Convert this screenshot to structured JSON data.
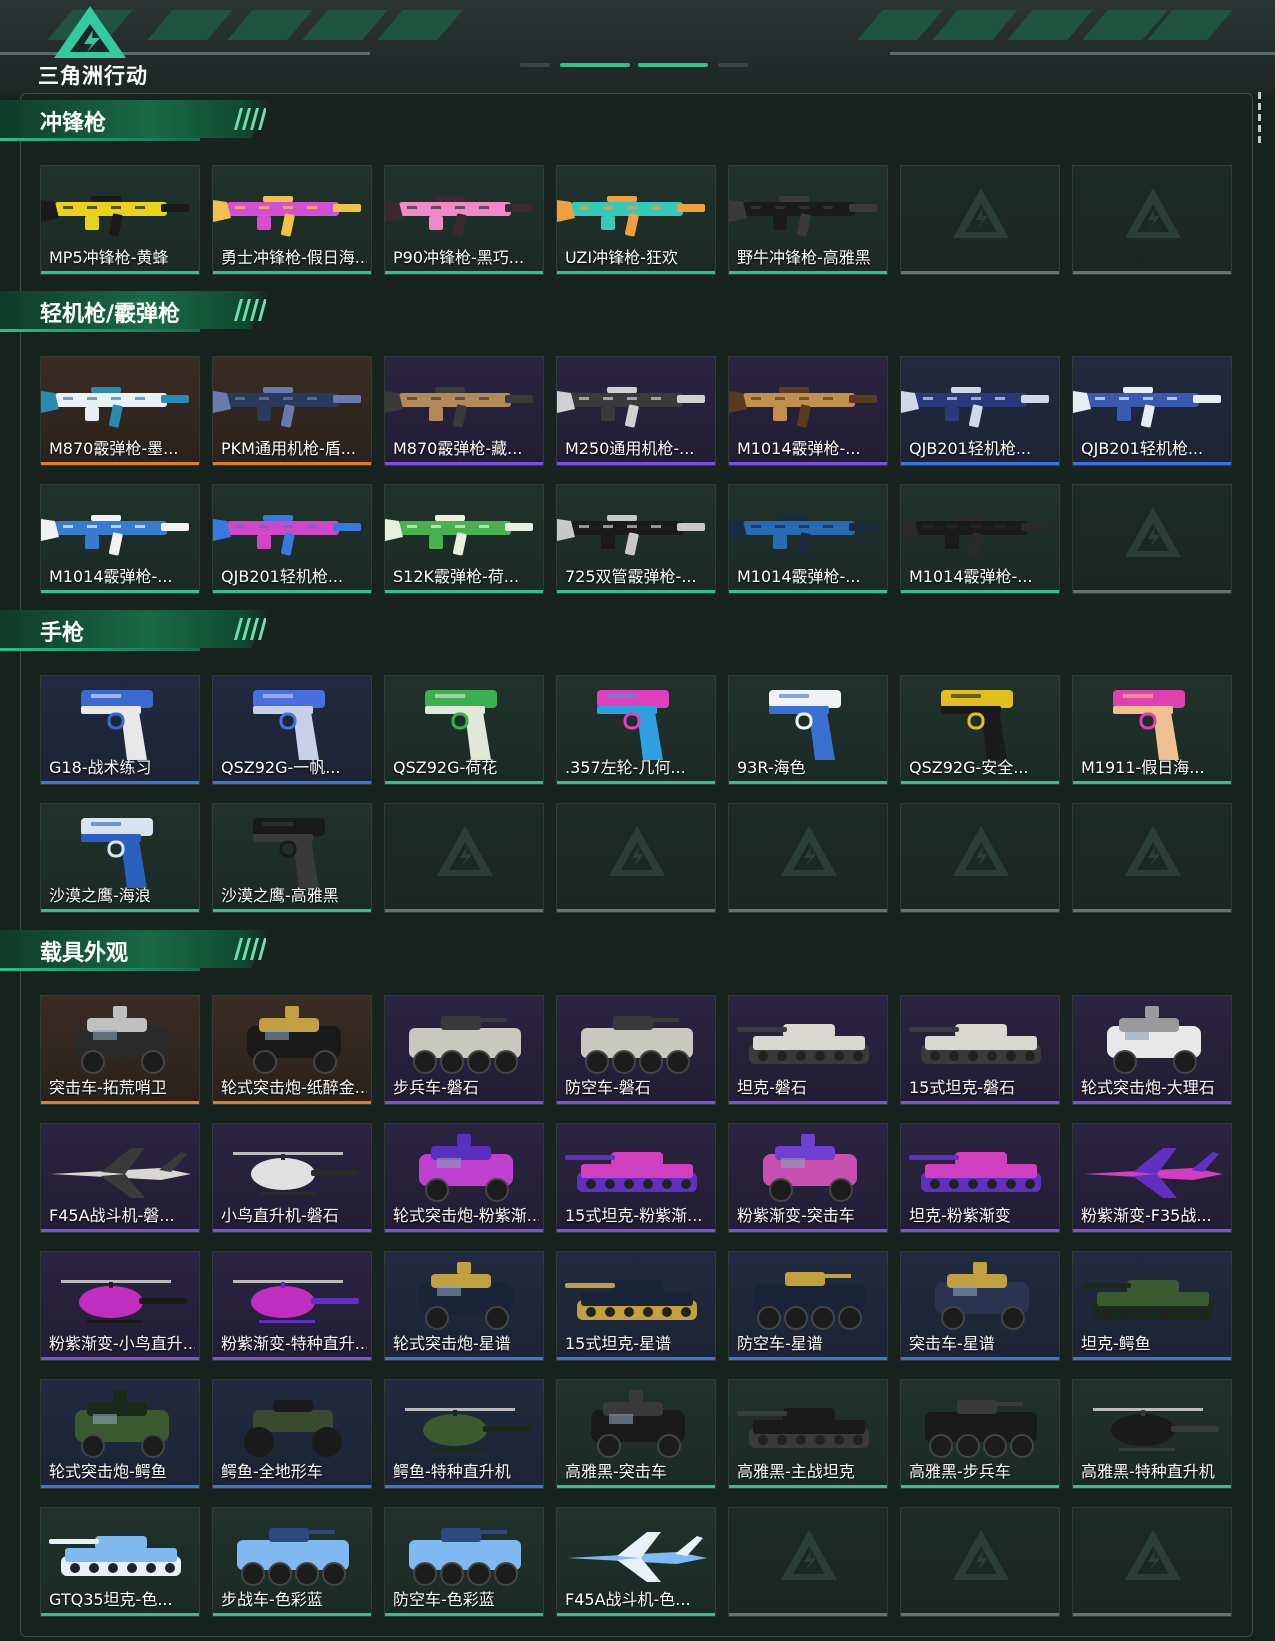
{
  "header": {
    "logo_text": "三角洲行动"
  },
  "colors": {
    "green": "#35c089",
    "blue": "#3b74e0",
    "purple": "#7d4fe0",
    "orange": "#e07a31",
    "empty": "#6b6f6d"
  },
  "sections": [
    {
      "title": "冲锋枪",
      "kind": "gun",
      "items": [
        {
          "label": "MP5冲锋枪-黄蜂",
          "quality": "green",
          "palette": [
            "#e8d21c",
            "#1a1a1a"
          ]
        },
        {
          "label": "勇士冲锋枪-假日海...",
          "quality": "green",
          "palette": [
            "#d44fd1",
            "#f1c24a"
          ]
        },
        {
          "label": "P90冲锋枪-黑巧...",
          "quality": "green",
          "palette": [
            "#f08ac6",
            "#3a2a30"
          ]
        },
        {
          "label": "UZI冲锋枪-狂欢",
          "quality": "green",
          "palette": [
            "#36c9b8",
            "#f0a040"
          ]
        },
        {
          "label": "野牛冲锋枪-高雅黑",
          "quality": "green",
          "palette": [
            "#1b1b1b",
            "#3a3a3a"
          ]
        },
        {
          "label": "",
          "quality": "empty"
        },
        {
          "label": "",
          "quality": "empty"
        }
      ]
    },
    {
      "title": "轻机枪/霰弹枪",
      "kind": "gun",
      "items": [
        {
          "label": "M870霰弹枪-墨...",
          "quality": "orange",
          "palette": [
            "#e8f0f4",
            "#2a8ab0"
          ]
        },
        {
          "label": "PKM通用机枪-盾...",
          "quality": "orange",
          "palette": [
            "#2a3a5a",
            "#6a7ab0"
          ]
        },
        {
          "label": "M870霰弹枪-藏...",
          "quality": "purple",
          "palette": [
            "#b08a5a",
            "#3a3a3a"
          ]
        },
        {
          "label": "M250通用机枪-...",
          "quality": "purple",
          "palette": [
            "#3a3a3a",
            "#d0d0d0"
          ]
        },
        {
          "label": "M1014霰弹枪-...",
          "quality": "purple",
          "palette": [
            "#c09050",
            "#5a3a20"
          ]
        },
        {
          "label": "QJB201轻机枪...",
          "quality": "blue",
          "palette": [
            "#2a3a7a",
            "#d0d8e8"
          ]
        },
        {
          "label": "QJB201轻机枪...",
          "quality": "blue",
          "palette": [
            "#3a5ab0",
            "#e8ecf4"
          ]
        },
        {
          "label": "M1014霰弹枪-...",
          "quality": "green",
          "palette": [
            "#3a7ad0",
            "#f0f2f4"
          ]
        },
        {
          "label": "QJB201轻机枪...",
          "quality": "green",
          "palette": [
            "#d048c8",
            "#3a7ae0"
          ]
        },
        {
          "label": "S12K霰弹枪-荷...",
          "quality": "green",
          "palette": [
            "#4ab050",
            "#e8f0e0"
          ]
        },
        {
          "label": "725双管霰弹枪-...",
          "quality": "green",
          "palette": [
            "#1a1a1a",
            "#c8c8c8"
          ]
        },
        {
          "label": "M1014霰弹枪-...",
          "quality": "green",
          "palette": [
            "#2a6ab0",
            "#1a2a40"
          ]
        },
        {
          "label": "M1014霰弹枪-...",
          "quality": "green",
          "palette": [
            "#1a1a1a",
            "#2a2a2a"
          ]
        },
        {
          "label": "",
          "quality": "empty"
        }
      ]
    },
    {
      "title": "手枪",
      "kind": "pistol",
      "items": [
        {
          "label": "G18-战术练习",
          "quality": "blue",
          "palette": [
            "#3a6ad0",
            "#e8e8e8"
          ]
        },
        {
          "label": "QSZ92G-一帆...",
          "quality": "blue",
          "palette": [
            "#4a70e0",
            "#c8d0e8"
          ]
        },
        {
          "label": "QSZ92G-荷花",
          "quality": "green",
          "palette": [
            "#3ab050",
            "#e0e8d8"
          ]
        },
        {
          "label": ".357左轮-几何...",
          "quality": "green",
          "palette": [
            "#e040c0",
            "#30a0e0"
          ]
        },
        {
          "label": "93R-海色",
          "quality": "green",
          "palette": [
            "#f0f2f8",
            "#3a70d0"
          ]
        },
        {
          "label": "QSZ92G-安全...",
          "quality": "green",
          "palette": [
            "#e0c020",
            "#1a1a1a"
          ]
        },
        {
          "label": "M1911-假日海...",
          "quality": "green",
          "palette": [
            "#e040b0",
            "#f0c090"
          ]
        },
        {
          "label": "沙漠之鹰-海浪",
          "quality": "green",
          "palette": [
            "#d8e4f0",
            "#2a60c0"
          ]
        },
        {
          "label": "沙漠之鹰-高雅黑",
          "quality": "green",
          "palette": [
            "#1a1a1a",
            "#3a3a3a"
          ]
        },
        {
          "label": "",
          "quality": "empty"
        },
        {
          "label": "",
          "quality": "empty"
        },
        {
          "label": "",
          "quality": "empty"
        },
        {
          "label": "",
          "quality": "empty"
        },
        {
          "label": "",
          "quality": "empty"
        }
      ]
    },
    {
      "title": "载具外观",
      "kind": "vehicle",
      "items": [
        {
          "label": "突击车-拓荒哨卫",
          "quality": "orange",
          "palette": [
            "#2a2a2a",
            "#c0c0c0"
          ],
          "shape": "car"
        },
        {
          "label": "轮式突击炮-纸醉金...",
          "quality": "orange",
          "palette": [
            "#1a1a1a",
            "#c0a040"
          ],
          "shape": "car"
        },
        {
          "label": "步兵车-磐石",
          "quality": "purple",
          "palette": [
            "#c8c8c0",
            "#3a3a3a"
          ],
          "shape": "apc"
        },
        {
          "label": "防空车-磐石",
          "quality": "purple",
          "palette": [
            "#c8c8c0",
            "#3a3a3a"
          ],
          "shape": "apc"
        },
        {
          "label": "坦克-磐石",
          "quality": "purple",
          "palette": [
            "#d8d8d0",
            "#3a3a3a"
          ],
          "shape": "tank"
        },
        {
          "label": "15式坦克-磐石",
          "quality": "purple",
          "palette": [
            "#d8d8d0",
            "#3a3a3a"
          ],
          "shape": "tank"
        },
        {
          "label": "轮式突击炮-大理石",
          "quality": "purple",
          "palette": [
            "#e8e8e8",
            "#9a9a9a"
          ],
          "shape": "car"
        },
        {
          "label": "F45A战斗机-磐...",
          "quality": "purple",
          "palette": [
            "#d8d8d0",
            "#3a3a3a"
          ],
          "shape": "jet"
        },
        {
          "label": "小鸟直升机-磐石",
          "quality": "purple",
          "palette": [
            "#e0e0e0",
            "#2a2a2a"
          ],
          "shape": "heli"
        },
        {
          "label": "轮式突击炮-粉紫渐...",
          "quality": "purple",
          "palette": [
            "#c040d0",
            "#5a30c0"
          ],
          "shape": "car"
        },
        {
          "label": "15式坦克-粉紫渐...",
          "quality": "purple",
          "palette": [
            "#d040c0",
            "#6030c0"
          ],
          "shape": "tank"
        },
        {
          "label": "粉紫渐变-突击车",
          "quality": "purple",
          "palette": [
            "#c850b0",
            "#7040d0"
          ],
          "shape": "car"
        },
        {
          "label": "坦克-粉紫渐变",
          "quality": "purple",
          "palette": [
            "#d040c0",
            "#6030c0"
          ],
          "shape": "tank"
        },
        {
          "label": "粉紫渐变-F35战...",
          "quality": "purple",
          "palette": [
            "#d040c0",
            "#6030c0"
          ],
          "shape": "jet"
        },
        {
          "label": "粉紫渐变-小鸟直升...",
          "quality": "purple",
          "palette": [
            "#c030c0",
            "#1a1a1a"
          ],
          "shape": "heli"
        },
        {
          "label": "粉紫渐变-特种直升...",
          "quality": "purple",
          "palette": [
            "#c030c0",
            "#6030c0"
          ],
          "shape": "heli"
        },
        {
          "label": "轮式突击炮-星谱",
          "quality": "blue",
          "palette": [
            "#1a2438",
            "#c0a040"
          ],
          "shape": "car"
        },
        {
          "label": "15式坦克-星谱",
          "quality": "blue",
          "palette": [
            "#1a2438",
            "#c0a040"
          ],
          "shape": "tank"
        },
        {
          "label": "防空车-星谱",
          "quality": "blue",
          "palette": [
            "#1a2438",
            "#c0a040"
          ],
          "shape": "apc"
        },
        {
          "label": "突击车-星谱",
          "quality": "blue",
          "palette": [
            "#2a3450",
            "#c0a040"
          ],
          "shape": "car"
        },
        {
          "label": "坦克-鳄鱼",
          "quality": "blue",
          "palette": [
            "#3a5a30",
            "#1a2a18"
          ],
          "shape": "tank"
        },
        {
          "label": "轮式突击炮-鳄鱼",
          "quality": "blue",
          "palette": [
            "#3a5a30",
            "#1a2a18"
          ],
          "shape": "car"
        },
        {
          "label": "鳄鱼-全地形车",
          "quality": "blue",
          "palette": [
            "#3a4a30",
            "#1a1a1a"
          ],
          "shape": "atv"
        },
        {
          "label": "鳄鱼-特种直升机",
          "quality": "blue",
          "palette": [
            "#3a5a30",
            "#1a2a18"
          ],
          "shape": "heli"
        },
        {
          "label": "高雅黑-突击车",
          "quality": "green",
          "palette": [
            "#1a1a1a",
            "#3a3a3a"
          ],
          "shape": "car"
        },
        {
          "label": "高雅黑-主战坦克",
          "quality": "green",
          "palette": [
            "#1a1a1a",
            "#3a3a3a"
          ],
          "shape": "tank"
        },
        {
          "label": "高雅黑-步兵车",
          "quality": "green",
          "palette": [
            "#1a1a1a",
            "#3a3a3a"
          ],
          "shape": "apc"
        },
        {
          "label": "高雅黑-特种直升机",
          "quality": "green",
          "palette": [
            "#1a1a1a",
            "#3a3a3a"
          ],
          "shape": "heli"
        },
        {
          "label": "GTQ35坦克-色...",
          "quality": "green",
          "palette": [
            "#80b8f0",
            "#e8f0f8"
          ],
          "shape": "tank"
        },
        {
          "label": "步战车-色彩蓝",
          "quality": "green",
          "palette": [
            "#80b8f0",
            "#2a4a80"
          ],
          "shape": "apc"
        },
        {
          "label": "防空车-色彩蓝",
          "quality": "green",
          "palette": [
            "#80b8f0",
            "#2a4a80"
          ],
          "shape": "apc"
        },
        {
          "label": "F45A战斗机-色...",
          "quality": "green",
          "palette": [
            "#80b8f0",
            "#e8f0f8"
          ],
          "shape": "jet"
        },
        {
          "label": "",
          "quality": "empty"
        },
        {
          "label": "",
          "quality": "empty"
        },
        {
          "label": "",
          "quality": "empty"
        }
      ]
    }
  ]
}
